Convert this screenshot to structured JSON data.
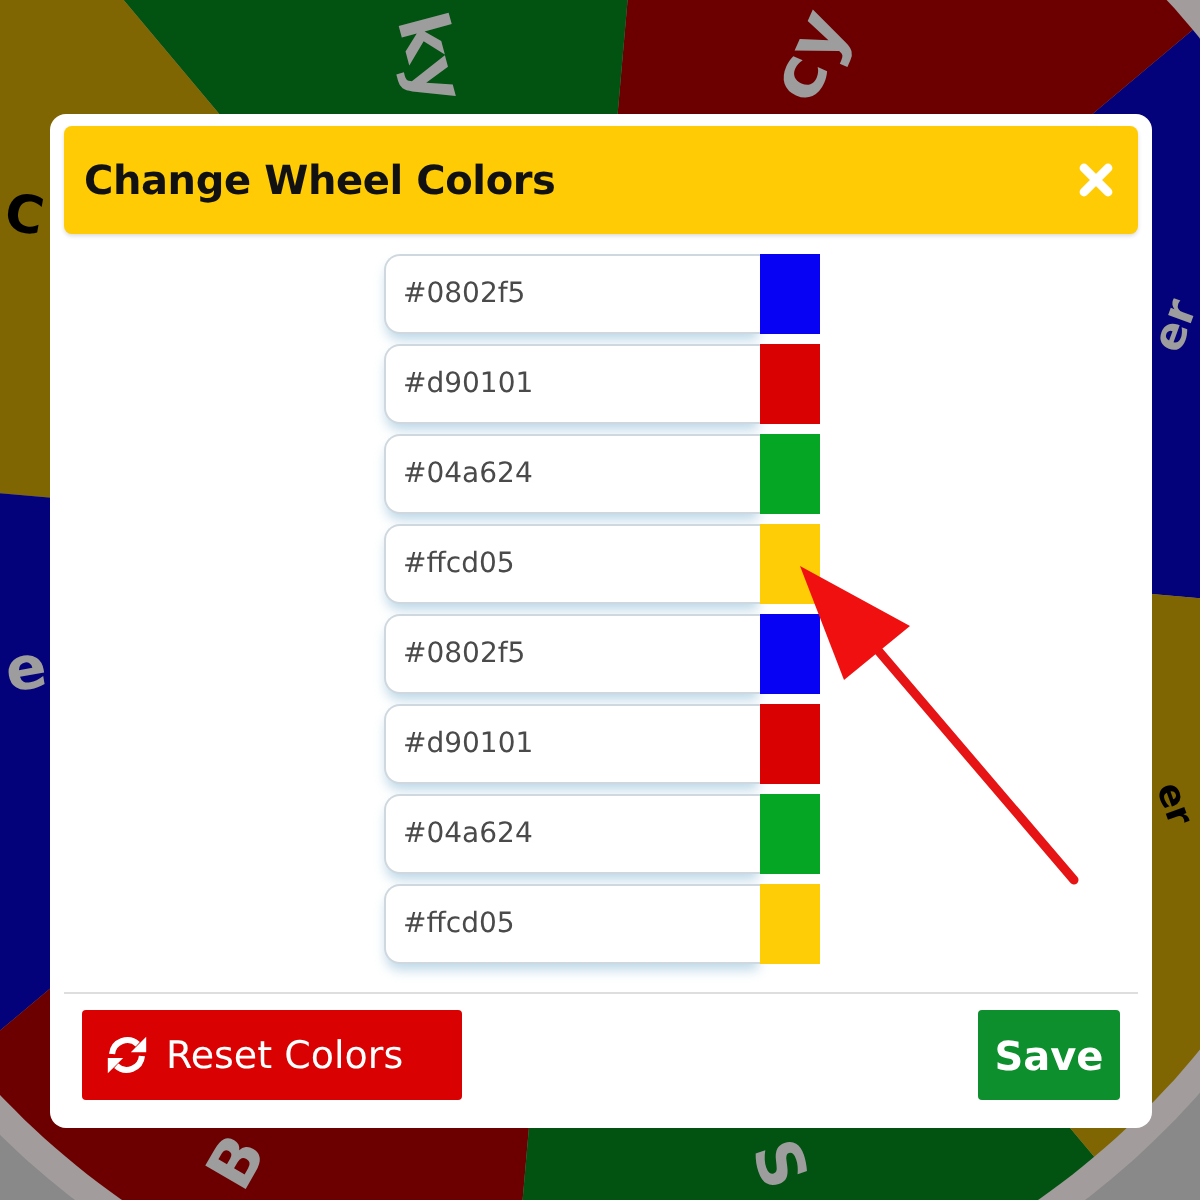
{
  "wheel": {
    "segments": [
      {
        "label": "er",
        "color": "#04027a"
      },
      {
        "label": "cy",
        "color": "#6c0000"
      },
      {
        "label": "ky",
        "color": "#025312"
      },
      {
        "label": "C",
        "color": "#7f6602"
      },
      {
        "label": "e",
        "color": "#04027a"
      },
      {
        "label": "B",
        "color": "#6c0000"
      },
      {
        "label": "S",
        "color": "#025312"
      },
      {
        "label": "er",
        "color": "#7f6602"
      }
    ]
  },
  "dialog": {
    "title": "Change Wheel Colors",
    "colors": [
      {
        "value": "#0802f5",
        "color": "#0802f5"
      },
      {
        "value": "#d90101",
        "color": "#d90101"
      },
      {
        "value": "#04a624",
        "color": "#04a624"
      },
      {
        "value": "#ffcd05",
        "color": "#ffcd05"
      },
      {
        "value": "#0802f5",
        "color": "#0802f5"
      },
      {
        "value": "#d90101",
        "color": "#d90101"
      },
      {
        "value": "#04a624",
        "color": "#04a624"
      },
      {
        "value": "#ffcd05",
        "color": "#ffcd05"
      }
    ],
    "buttons": [
      {
        "label": "Reset Colors",
        "kind": "reset"
      },
      {
        "label": "Save",
        "kind": "save"
      }
    ]
  },
  "annotation": {
    "kind": "arrow"
  }
}
